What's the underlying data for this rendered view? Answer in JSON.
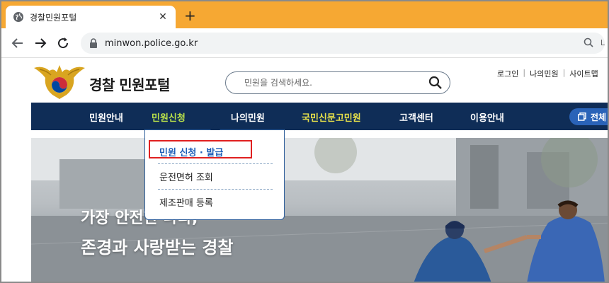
{
  "browser": {
    "tab_title": "경찰민원포털",
    "tab_close": "✕",
    "new_tab": "+",
    "url": "minwon.police.go.kr",
    "extension_partial": "L"
  },
  "header": {
    "site_title": "경찰 민원포털",
    "search_placeholder": "민원을 검색하세요.",
    "util_links": [
      "로그인",
      "나의민원",
      "사이트맵"
    ],
    "util_sep": "|"
  },
  "gnb": {
    "items": [
      {
        "label": "민원안내"
      },
      {
        "label": "민원신청"
      },
      {
        "label": "나의민원"
      },
      {
        "label": "국민신문고민원"
      },
      {
        "label": "고객센터"
      },
      {
        "label": "이용안내"
      }
    ],
    "all_menu_label": "전체"
  },
  "dropdown": {
    "items": [
      {
        "label": "민원 신청 · 발급"
      },
      {
        "label": "운전면허 조회"
      },
      {
        "label": "제조판매 등록"
      }
    ]
  },
  "hero": {
    "line1": "가장 안전한 나라,",
    "line2": "존경과 사랑받는 경찰"
  },
  "colors": {
    "tabbar": "#f6a833",
    "gnb": "#0f2d57",
    "active_menu": "#b8e04a",
    "highlight": "#e02020"
  }
}
